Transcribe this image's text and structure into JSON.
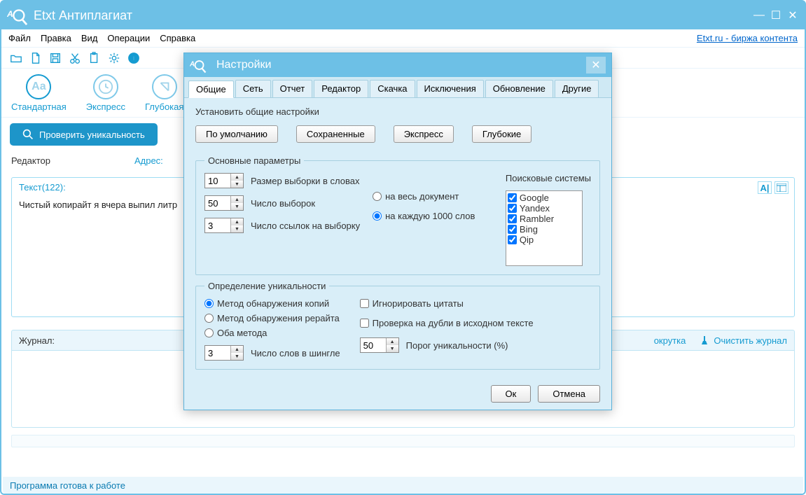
{
  "app": {
    "title": "Etxt Антиплагиат",
    "link_label": "Etxt.ru - биржа контента",
    "status": "Программа готова к работе"
  },
  "menu": {
    "file": "Файл",
    "edit": "Правка",
    "view": "Вид",
    "ops": "Операции",
    "help": "Справка"
  },
  "modes": {
    "standard": "Стандартная",
    "express": "Экспресс",
    "deep": "Глубокая"
  },
  "buttons": {
    "check": "Проверить уникальность"
  },
  "editor": {
    "label": "Редактор",
    "address_label": "Адрес:",
    "text_count": "Текст(122):",
    "content": "Чистый копирайт я вчера выпил литр"
  },
  "journal": {
    "label": "Журнал:",
    "scroll": "окрутка",
    "clear": "Очистить журнал"
  },
  "dialog": {
    "title": "Настройки",
    "tabs": {
      "general": "Общие",
      "net": "Сеть",
      "report": "Отчет",
      "editor": "Редактор",
      "download": "Скачка",
      "exclude": "Исключения",
      "update": "Обновление",
      "other": "Другие"
    },
    "presets_label": "Установить общие настройки",
    "presets": {
      "default": "По умолчанию",
      "saved": "Сохраненные",
      "express": "Экспресс",
      "deep": "Глубокие"
    },
    "params_legend": "Основные параметры",
    "sample_size_val": "10",
    "sample_size_lbl": "Размер выборки в словах",
    "sample_count_val": "50",
    "sample_count_lbl": "Число выборок",
    "links_val": "3",
    "links_lbl": "Число ссылок на выборку",
    "scope": {
      "whole": "на весь документ",
      "per1000": "на каждую 1000 слов"
    },
    "se_label": "Поисковые системы",
    "se": {
      "google": "Google",
      "yandex": "Yandex",
      "rambler": "Rambler",
      "bing": "Bing",
      "qip": "Qip"
    },
    "uniq_legend": "Определение уникальности",
    "method": {
      "copy": "Метод обнаружения копий",
      "rewrite": "Метод обнаружения рерайта",
      "both": "Оба метода"
    },
    "shingle_val": "3",
    "shingle_lbl": "Число слов в шингле",
    "ignore_quotes": "Игнорировать цитаты",
    "check_dups": "Проверка на дубли в исходном тексте",
    "thresh_val": "50",
    "thresh_lbl": "Порог уникальности (%)",
    "ok": "Ок",
    "cancel": "Отмена"
  }
}
